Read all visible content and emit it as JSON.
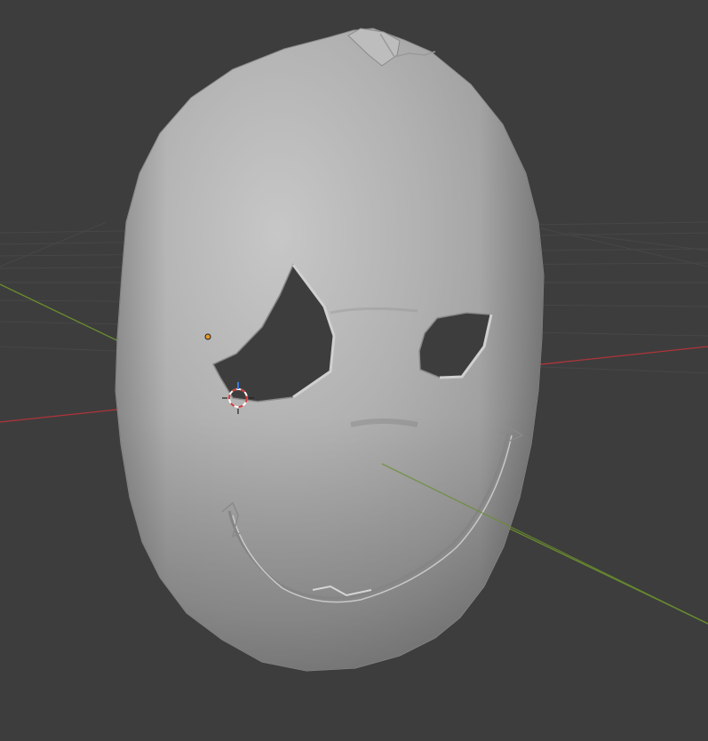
{
  "viewport": {
    "background_color": "#3d3d3d",
    "grid_color": "#474747",
    "x_axis_color": "#b0343a",
    "y_axis_color": "#6a8d2e"
  },
  "mesh": {
    "name": "mask",
    "base_color": "#a8a8a8",
    "highlight_color": "#c6c6c6",
    "shadow_color": "#7a7a7a"
  },
  "scene_objects": {
    "light_origin_color": "#e8982a",
    "cursor_ring_colors": [
      "#d23a3a",
      "#ffffff"
    ],
    "gizmo_z_color": "#3b7bd8"
  }
}
